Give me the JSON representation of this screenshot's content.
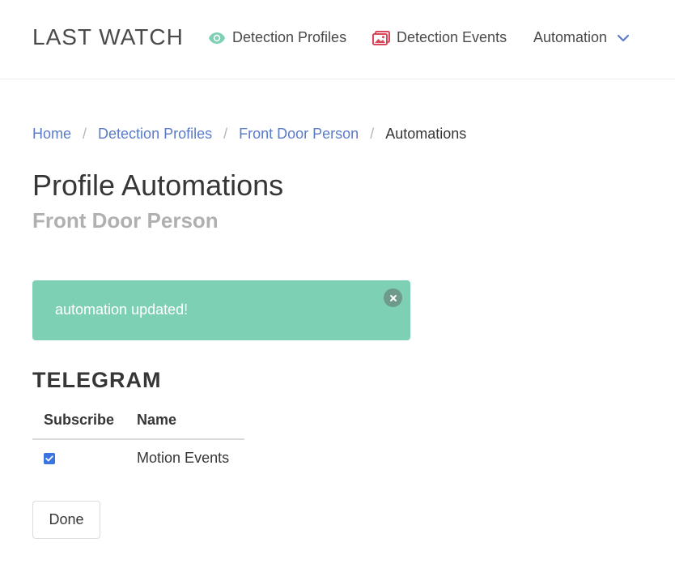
{
  "navbar": {
    "brand": "LAST WATCH",
    "items": [
      {
        "label": "Detection Profiles",
        "icon": "eye-icon",
        "icon_color": "#7dd0b4"
      },
      {
        "label": "Detection Events",
        "icon": "images-icon",
        "icon_color": "#d9475a"
      },
      {
        "label": "Automation",
        "icon": "chevron-down-icon",
        "icon_color": "#5b7bc9"
      }
    ]
  },
  "breadcrumb": {
    "items": [
      "Home",
      "Detection Profiles",
      "Front Door Person"
    ],
    "current": "Automations",
    "separator": "/"
  },
  "page": {
    "title": "Profile Automations",
    "subtitle": "Front Door Person"
  },
  "notification": {
    "message": "automation updated!",
    "color": "#7dd0b4"
  },
  "section": {
    "title": "TELEGRAM"
  },
  "table": {
    "headers": [
      "Subscribe",
      "Name"
    ],
    "rows": [
      {
        "subscribed": true,
        "name": "Motion Events"
      }
    ]
  },
  "actions": {
    "done_label": "Done"
  },
  "colors": {
    "link": "#5b7bc9",
    "checkbox": "#3b73e0"
  }
}
